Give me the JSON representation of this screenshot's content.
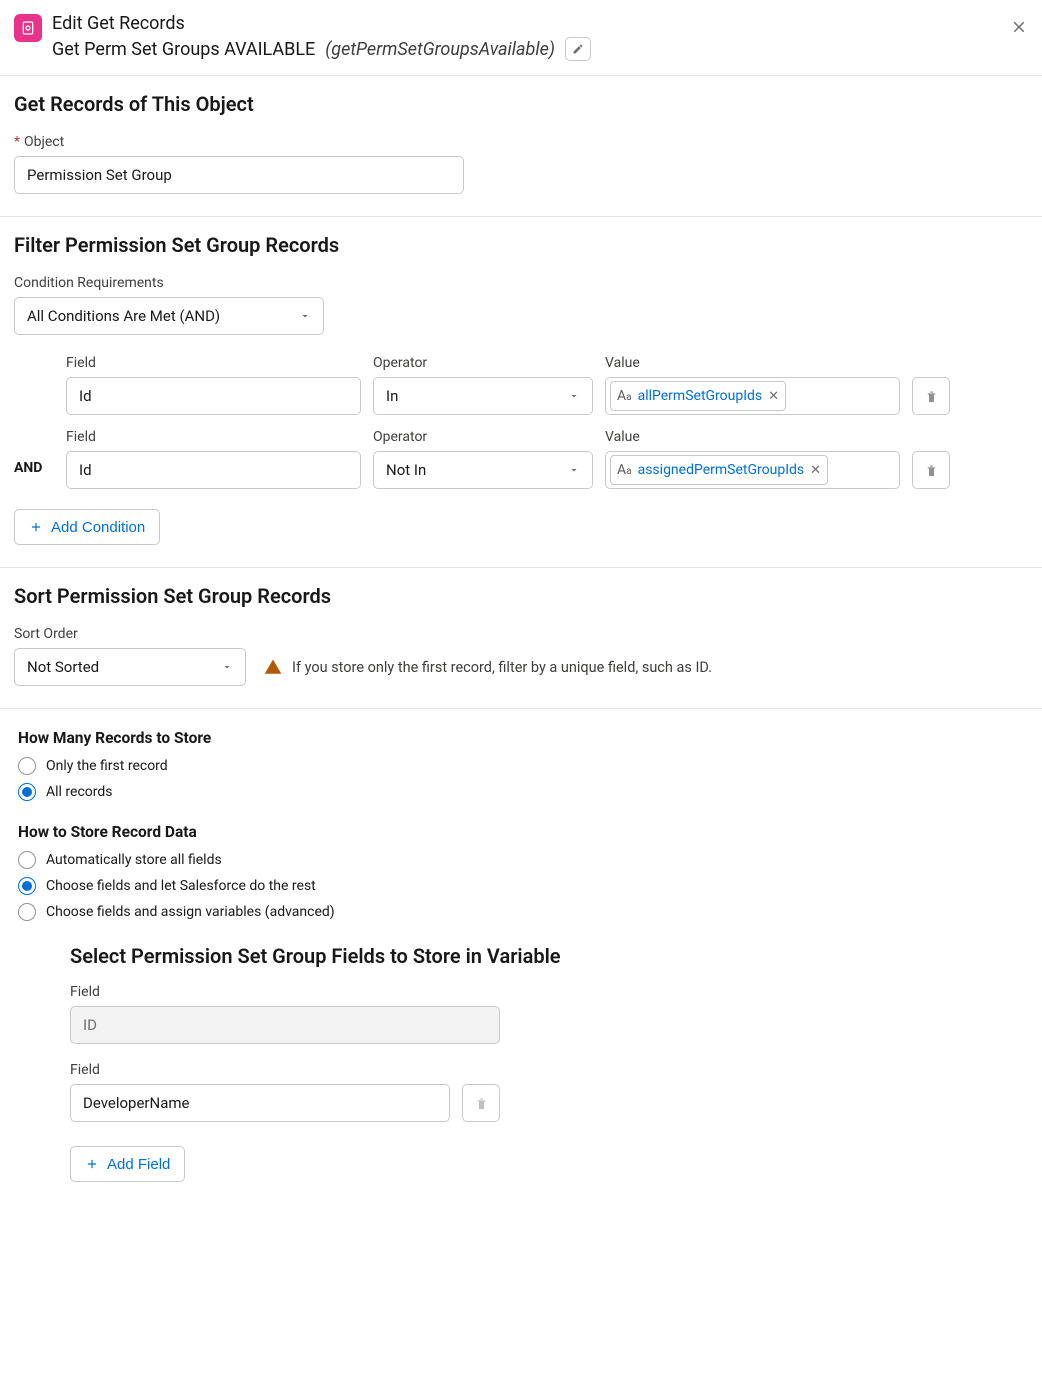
{
  "header": {
    "title": "Edit Get Records",
    "name": "Get Perm Set Groups AVAILABLE",
    "apiName": "(getPermSetGroupsAvailable)"
  },
  "object": {
    "section_title": "Get Records of This Object",
    "label": "Object",
    "value": "Permission Set Group"
  },
  "filter": {
    "section_title": "Filter Permission Set Group Records",
    "cond_req_label": "Condition Requirements",
    "cond_req_value": "All Conditions Are Met (AND)",
    "col_field": "Field",
    "col_operator": "Operator",
    "col_value": "Value",
    "and_label": "AND",
    "rows": [
      {
        "field": "Id",
        "operator": "In",
        "value_token": "allPermSetGroupIds"
      },
      {
        "field": "Id",
        "operator": "Not In",
        "value_token": "assignedPermSetGroupIds"
      }
    ],
    "add_condition": "Add Condition"
  },
  "sort": {
    "section_title": "Sort Permission Set Group Records",
    "label": "Sort Order",
    "value": "Not Sorted",
    "warning": "If you store only the first record, filter by a unique field, such as ID."
  },
  "store": {
    "how_many_title": "How Many Records to Store",
    "how_many_options": [
      "Only the first record",
      "All records"
    ],
    "how_many_selected": 1,
    "how_store_title": "How to Store Record Data",
    "how_store_options": [
      "Automatically store all fields",
      "Choose fields and let Salesforce do the rest",
      "Choose fields and assign variables (advanced)"
    ],
    "how_store_selected": 1,
    "select_fields_title": "Select Permission Set Group Fields to Store in Variable",
    "field_label": "Field",
    "fields": [
      {
        "value": "ID",
        "readonly": true
      },
      {
        "value": "DeveloperName",
        "readonly": false
      }
    ],
    "add_field": "Add Field"
  }
}
